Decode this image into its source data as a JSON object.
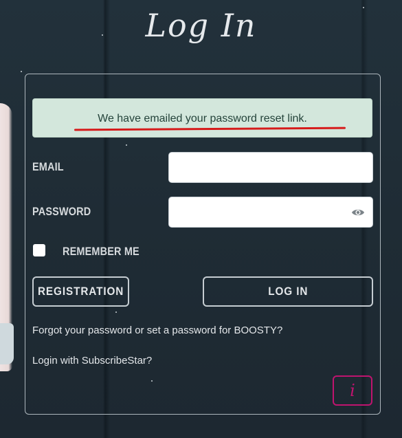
{
  "page": {
    "title": "Log In"
  },
  "alert": {
    "message": "We have emailed your password reset link.",
    "highlight_color": "#d61b1b"
  },
  "form": {
    "email_label": "EMAIL",
    "email_value": "",
    "password_label": "PASSWORD",
    "password_value": "",
    "password_toggle_icon": "eye-icon",
    "remember_label": "REMEMBER ME",
    "remember_checked": false
  },
  "buttons": {
    "registration": "REGISTRATION",
    "login": "LOG IN",
    "info": "i"
  },
  "links": {
    "forgot": "Forgot your password or set a password for BOOSTY?",
    "subscribestar": "Login with SubscribeStar?"
  },
  "colors": {
    "accent": "#c0146f",
    "background": "#1f2c36",
    "alert_bg": "#d3e7dc"
  }
}
